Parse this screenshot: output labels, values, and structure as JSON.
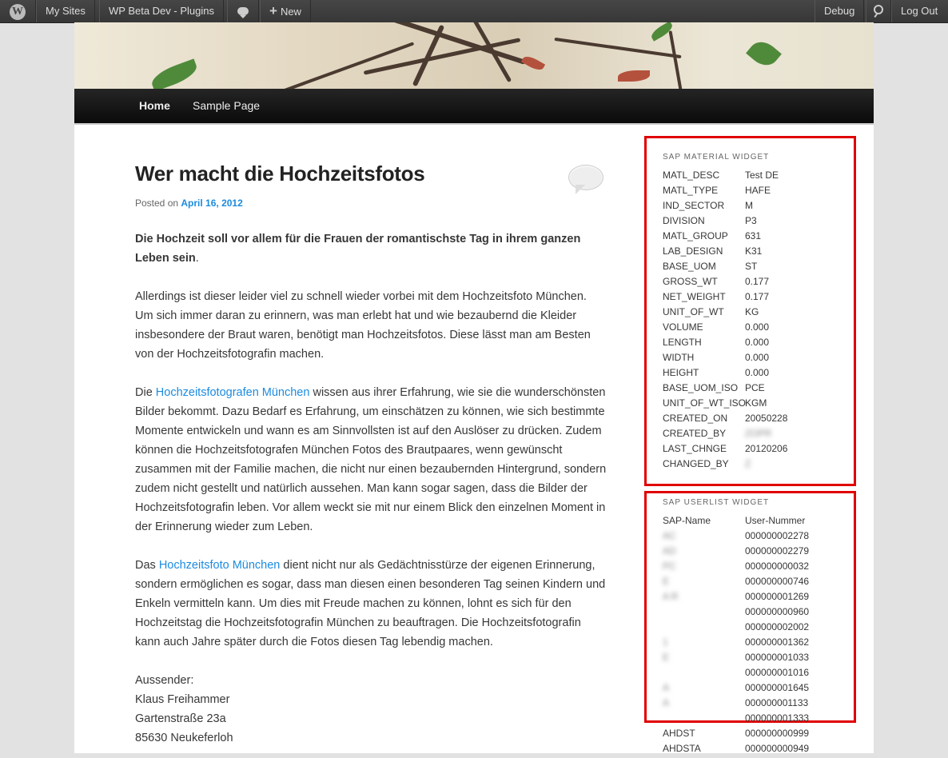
{
  "adminbar": {
    "my_sites": "My Sites",
    "site_name": "WP Beta Dev - Plugins",
    "new_label": "New",
    "debug": "Debug",
    "logout": "Log Out"
  },
  "nav": {
    "home": "Home",
    "sample": "Sample Page"
  },
  "post": {
    "title": "Wer macht die Hochzeitsfotos",
    "posted_on": "Posted on",
    "date": "April 16, 2012",
    "lead": "Die Hochzeit soll vor allem für die Frauen der romantischste Tag in ihrem ganzen Leben sein",
    "p1": "Allerdings ist dieser leider viel zu schnell wieder vorbei mit dem Hochzeitsfoto München. Um sich immer daran zu erinnern, was man erlebt hat und wie bezaubernd die Kleider insbesondere der Braut waren, benötigt man Hochzeitsfotos. Diese lässt man am Besten von der Hochzeitsfotografin machen.",
    "p2_pre": "Die",
    "p2_link": "Hochzeitsfotografen München",
    "p2_post": "wissen aus ihrer Erfahrung, wie sie die wunderschönsten Bilder bekommt. Dazu Bedarf es Erfahrung, um einschätzen zu können, wie sich bestimmte Momente entwickeln und wann es am Sinnvollsten ist auf den Auslöser zu drücken. Zudem können die Hochzeitsfotografen München Fotos des Brautpaares, wenn gewünscht zusammen mit der Familie machen, die nicht nur einen bezaubernden Hintergrund, sondern zudem nicht gestellt und natürlich aussehen. Man kann sogar sagen, dass die Bilder der Hochzeitsfotografin leben. Vor allem weckt sie mit nur einem Blick den einzelnen Moment in der Erinnerung wieder zum Leben.",
    "p3_pre": "Das",
    "p3_link": "Hochzeitsfoto München",
    "p3_post": "dient nicht nur als Gedächtnisstürze der eigenen Erinnerung, sondern ermöglichen es sogar, dass man diesen einen besonderen Tag seinen Kindern und Enkeln vermitteln kann. Um dies mit Freude machen zu können, lohnt es sich für den Hochzeitstag die Hochzeitsfotografin München zu beauftragen. Die Hochzeitsfotografin kann auch Jahre später durch die Fotos diesen Tag lebendig machen.",
    "addr1": "Aussender:",
    "addr2": "Klaus Freihammer",
    "addr3": "Gartenstraße 23a",
    "addr4": "85630 Neukeferloh"
  },
  "material_widget": {
    "title": "SAP MATERIAL WIDGET",
    "rows": [
      [
        "MATL_DESC",
        "Test DE"
      ],
      [
        "MATL_TYPE",
        "HAFE"
      ],
      [
        "IND_SECTOR",
        "M"
      ],
      [
        "DIVISION",
        "P3"
      ],
      [
        "MATL_GROUP",
        "631"
      ],
      [
        "LAB_DESIGN",
        "K31"
      ],
      [
        "BASE_UOM",
        "ST"
      ],
      [
        "GROSS_WT",
        "0.177"
      ],
      [
        "NET_WEIGHT",
        "0.177"
      ],
      [
        "UNIT_OF_WT",
        "KG"
      ],
      [
        "VOLUME",
        "0.000"
      ],
      [
        "LENGTH",
        "0.000"
      ],
      [
        "WIDTH",
        "0.000"
      ],
      [
        "HEIGHT",
        "0.000"
      ],
      [
        "BASE_UOM_ISO",
        "PCE"
      ],
      [
        "UNIT_OF_WT_ISO",
        "KGM"
      ],
      [
        "CREATED_ON",
        "20050228"
      ],
      [
        "CREATED_BY",
        "ZOPR"
      ],
      [
        "LAST_CHNGE",
        "20120206"
      ],
      [
        "CHANGED_BY",
        "Z"
      ]
    ]
  },
  "userlist_widget": {
    "title": "SAP USERLIST WIDGET",
    "col_name": "SAP-Name",
    "col_number": "User-Nummer",
    "rows": [
      [
        "AC",
        "000000002278"
      ],
      [
        "AD",
        "000000002279"
      ],
      [
        "PC",
        "000000000032"
      ],
      [
        "E",
        "000000000746"
      ],
      [
        "A R",
        "000000001269"
      ],
      [
        "",
        "000000000960"
      ],
      [
        "",
        "000000002002"
      ],
      [
        "1",
        "000000001362"
      ],
      [
        "E",
        "000000001033"
      ],
      [
        "",
        "000000001016"
      ],
      [
        "A",
        "000000001645"
      ],
      [
        "A",
        "000000001133"
      ],
      [
        "",
        "000000001333"
      ],
      [
        "AHDST",
        "000000000999"
      ],
      [
        "AHDSTA",
        "000000000949"
      ]
    ]
  }
}
